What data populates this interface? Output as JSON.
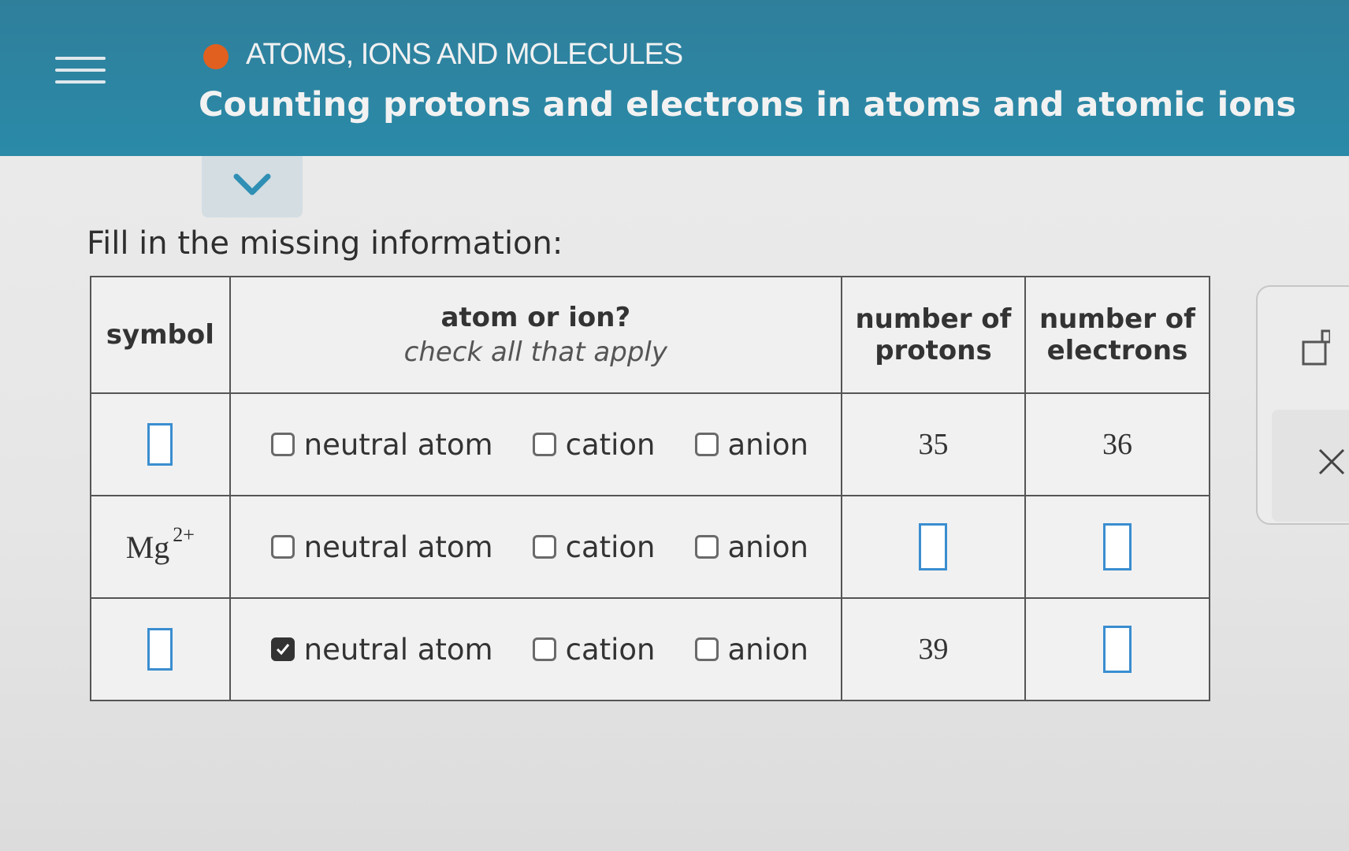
{
  "header": {
    "topic": "ATOMS, IONS AND MOLECULES",
    "title": "Counting protons and electrons in atoms and atomic ions",
    "colors": {
      "background": "#2a8aa8",
      "topic_dot": "#e2601f"
    }
  },
  "instruction": "Fill in the missing information:",
  "table": {
    "headers": {
      "symbol": "symbol",
      "atom_or_ion": "atom or ion?",
      "atom_or_ion_hint": "check all that apply",
      "protons": "number of protons",
      "electrons": "number of electrons"
    },
    "option_labels": [
      "neutral atom",
      "cation",
      "anion"
    ],
    "rows": [
      {
        "symbol": "",
        "symbol_charge": "",
        "symbol_is_input": true,
        "checked": [
          false,
          false,
          false
        ],
        "protons": "35",
        "protons_is_input": false,
        "electrons": "36",
        "electrons_is_input": false
      },
      {
        "symbol": "Mg",
        "symbol_charge": "2+",
        "symbol_is_input": false,
        "checked": [
          false,
          false,
          false
        ],
        "protons": "",
        "protons_is_input": true,
        "electrons": "",
        "electrons_is_input": true
      },
      {
        "symbol": "",
        "symbol_charge": "",
        "symbol_is_input": true,
        "checked": [
          true,
          false,
          false
        ],
        "protons": "39",
        "protons_is_input": false,
        "electrons": "",
        "electrons_is_input": true
      }
    ]
  },
  "side_panel": {
    "icons": [
      "superscript-icon",
      "close-icon"
    ]
  }
}
